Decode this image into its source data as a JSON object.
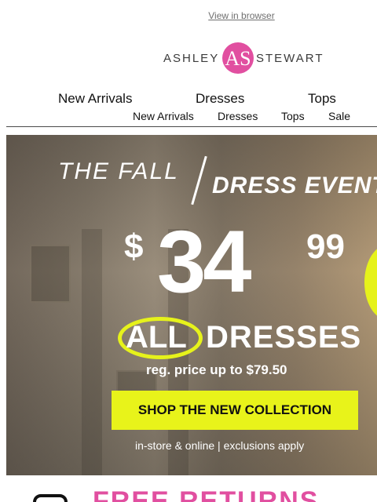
{
  "header": {
    "view_in_browser": "View in browser",
    "logo_left": "ASHLEY",
    "logo_right": "STEWART",
    "logo_mark": "AS"
  },
  "nav_primary": [
    "New Arrivals",
    "Dresses",
    "Tops"
  ],
  "nav_secondary": [
    "New Arrivals",
    "Dresses",
    "Tops",
    "Sale"
  ],
  "hero": {
    "title_part1": "THE FALL",
    "title_part2": "DRESS EVENT",
    "price_currency": "$",
    "price_main": "34",
    "price_cents": "99",
    "all": "ALL",
    "dresses": "DRESSES",
    "reg_price": "reg. price up to $79.50",
    "cta": "SHOP THE NEW COLLECTION",
    "fine_print": "in-store & online | exclusions apply"
  },
  "promo_strip": {
    "text": "FREE RETURNS"
  },
  "colors": {
    "brand_pink": "#e14fa0",
    "accent_yellow": "#e8f31a"
  }
}
